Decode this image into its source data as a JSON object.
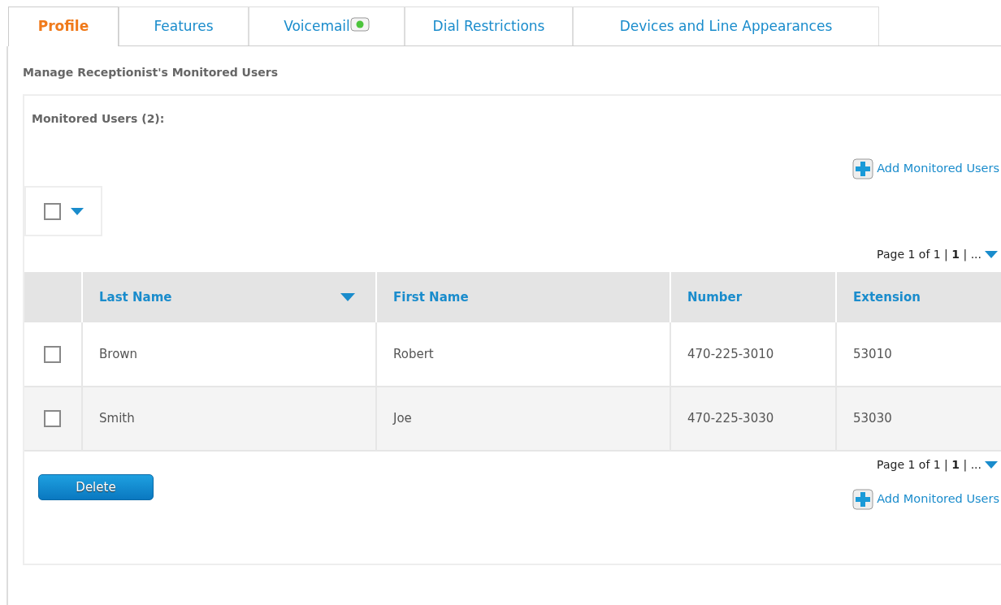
{
  "tabs": [
    {
      "label": "Profile",
      "selected": true,
      "indicator": false
    },
    {
      "label": "Features",
      "selected": false,
      "indicator": false
    },
    {
      "label": "Voicemail",
      "selected": false,
      "indicator": true
    },
    {
      "label": "Dial Restrictions",
      "selected": false,
      "indicator": false
    },
    {
      "label": "Devices and Line Appearances",
      "selected": false,
      "indicator": false
    }
  ],
  "heading": "Manage Receptionist's Monitored Users",
  "panel": {
    "title": "Monitored Users (2):",
    "add_link_top": "Add Monitored Users",
    "select_all": {
      "checked": false
    },
    "pagination_top": "Page 1 of 1 | **1** | ...",
    "columns": [
      {
        "label": "Last Name",
        "sorted": true
      },
      {
        "label": "First Name",
        "sorted": false
      },
      {
        "label": "Number",
        "sorted": false
      },
      {
        "label": "Extension",
        "sorted": false
      }
    ],
    "rows": [
      {
        "checked": false,
        "cells": [
          "Brown",
          "Robert",
          "470-225-3010",
          "53010"
        ]
      },
      {
        "checked": false,
        "cells": [
          "Smith",
          "Joe",
          "470-225-3030",
          "53030"
        ]
      }
    ],
    "pagination_bottom": "Page 1 of 1 | **1** | ...",
    "delete_button": "Delete",
    "add_link_bottom": "Add Monitored Users"
  }
}
